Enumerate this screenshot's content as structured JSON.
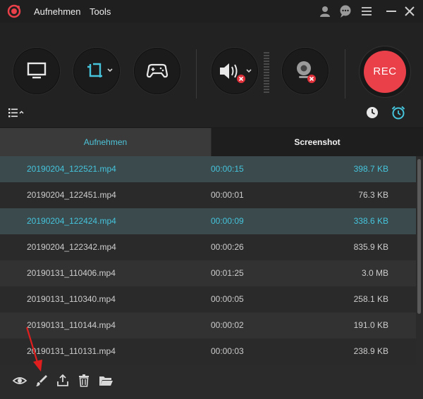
{
  "titlebar": {
    "menu": [
      "Aufnehmen",
      "Tools"
    ],
    "icons": [
      "logo-icon",
      "account-icon",
      "chat-icon",
      "menu-icon",
      "minimize-icon",
      "close-icon"
    ]
  },
  "toolbar": {
    "rec_label": "REC",
    "icons": [
      "monitor-icon",
      "crop-icon",
      "gamepad-icon",
      "speaker-muted-icon",
      "webcam-off-icon",
      "list-options-icon",
      "history-clock-icon",
      "alarm-clock-icon"
    ]
  },
  "tabs": [
    {
      "label": "Aufnehmen",
      "active": true
    },
    {
      "label": "Screenshot",
      "active": false
    }
  ],
  "files": [
    {
      "name": "20190204_122521.mp4",
      "duration": "00:00:15",
      "size": "398.7 KB",
      "selected": true
    },
    {
      "name": "20190204_122451.mp4",
      "duration": "00:00:01",
      "size": "76.3 KB",
      "selected": false
    },
    {
      "name": "20190204_122424.mp4",
      "duration": "00:00:09",
      "size": "338.6 KB",
      "selected": true
    },
    {
      "name": "20190204_122342.mp4",
      "duration": "00:00:26",
      "size": "835.9 KB",
      "selected": false
    },
    {
      "name": "20190131_110406.mp4",
      "duration": "00:01:25",
      "size": "3.0 MB",
      "selected": false
    },
    {
      "name": "20190131_110340.mp4",
      "duration": "00:00:05",
      "size": "258.1 KB",
      "selected": false
    },
    {
      "name": "20190131_110144.mp4",
      "duration": "00:00:02",
      "size": "191.0 KB",
      "selected": false
    },
    {
      "name": "20190131_110131.mp4",
      "duration": "00:00:03",
      "size": "238.9 KB",
      "selected": false
    }
  ],
  "bottom_icons": [
    "preview-eye-icon",
    "edit-brush-icon",
    "upload-icon",
    "delete-trash-icon",
    "open-folder-icon"
  ],
  "colors": {
    "accent": "#45c4dc",
    "rec": "#e9404a",
    "muted_badge": "#e0303a",
    "annotation_arrow": "#e01e1e"
  }
}
